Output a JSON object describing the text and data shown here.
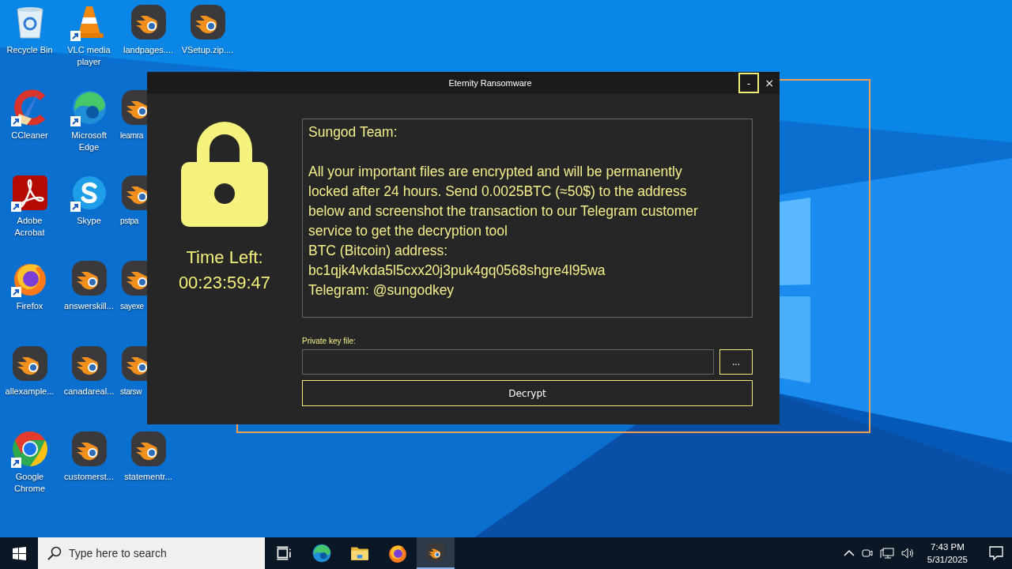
{
  "desktop": {
    "icons": [
      {
        "label": "Recycle Bin",
        "kind": "recycle",
        "shortcut": false,
        "covered": false
      },
      {
        "label": "CCleaner",
        "kind": "ccleaner",
        "shortcut": true,
        "covered": false
      },
      {
        "label": "Adobe Acrobat",
        "kind": "acrobat",
        "shortcut": true,
        "covered": false
      },
      {
        "label": "Firefox",
        "kind": "firefox",
        "shortcut": true,
        "covered": false
      },
      {
        "label": "allexample...",
        "kind": "blender",
        "shortcut": false,
        "covered": false
      },
      {
        "label": "Google Chrome",
        "kind": "chrome",
        "shortcut": true,
        "covered": false
      },
      {
        "label": "VLC media player",
        "kind": "vlc",
        "shortcut": true,
        "covered": false
      },
      {
        "label": "Microsoft Edge",
        "kind": "edge",
        "shortcut": true,
        "covered": false
      },
      {
        "label": "Skype",
        "kind": "skype",
        "shortcut": true,
        "covered": false
      },
      {
        "label": "answerskill...",
        "kind": "blender",
        "shortcut": false,
        "covered": false
      },
      {
        "label": "canadareal...",
        "kind": "blender",
        "shortcut": false,
        "covered": false
      },
      {
        "label": "customerst...",
        "kind": "blender",
        "shortcut": false,
        "covered": false
      },
      {
        "label": "landpages....",
        "kind": "blender",
        "shortcut": false,
        "covered": false
      },
      {
        "label": "learnra",
        "kind": "blender",
        "shortcut": false,
        "covered": true
      },
      {
        "label": "pstpa",
        "kind": "blender",
        "shortcut": false,
        "covered": true
      },
      {
        "label": "sayexe",
        "kind": "blender",
        "shortcut": false,
        "covered": true
      },
      {
        "label": "starsw",
        "kind": "blender",
        "shortcut": false,
        "covered": true
      },
      {
        "label": "statementr...",
        "kind": "blender",
        "shortcut": false,
        "covered": false
      },
      {
        "label": "VSetup.zip....",
        "kind": "blender",
        "shortcut": false,
        "covered": false
      }
    ]
  },
  "window": {
    "title": "Eternity Ransomware",
    "controls": [
      {
        "label": "-",
        "kind": "minimize",
        "selected": true
      },
      {
        "label": "×",
        "kind": "close",
        "selected": false
      }
    ],
    "timer": {
      "label": "Time Left:",
      "value": "00:23:59:47"
    },
    "message": {
      "greeting": "Sungod Team:",
      "body": "All your important files are encrypted and will be permanently locked after 24 hours. Send 0.0025BTC (≈50$) to the address below and screenshot the transaction to our Telegram customer service to get the decryption tool",
      "lines": [
        "BTC (Bitcoin) address:",
        "bc1qjk4vkda5l5cxx20j3puk4gq0568shgre4l95wa",
        "Telegram: @sungodkey"
      ]
    },
    "key_field": {
      "label": "Private key file:"
    },
    "browse_button": "...",
    "decrypt_button": "Decrypt"
  },
  "taskbar": {
    "search": {
      "placeholder": "Type here to search"
    },
    "apps": [
      {
        "kind": "taskview",
        "selected": false
      },
      {
        "kind": "edge",
        "selected": false
      },
      {
        "kind": "folder",
        "selected": false
      },
      {
        "kind": "firefox",
        "selected": false
      },
      {
        "kind": "blender",
        "selected": true
      }
    ],
    "time": "7:43 PM",
    "date": "5/31/2025"
  }
}
